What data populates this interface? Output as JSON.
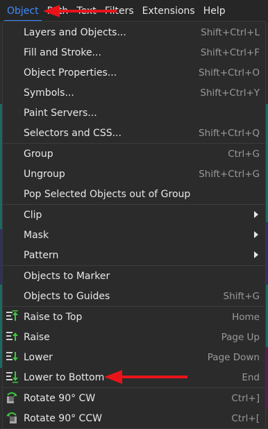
{
  "menubar": {
    "items": [
      "Object",
      "Path",
      "Text",
      "Filters",
      "Extensions",
      "Help"
    ]
  },
  "menu": {
    "items": [
      {
        "label": "Layers and Objects...",
        "shortcut": "Shift+Ctrl+L"
      },
      {
        "label": "Fill and Stroke...",
        "shortcut": "Shift+Ctrl+F"
      },
      {
        "label": "Object Properties...",
        "shortcut": "Shift+Ctrl+O"
      },
      {
        "label": "Symbols...",
        "shortcut": "Shift+Ctrl+Y"
      },
      {
        "label": "Paint Servers...",
        "shortcut": ""
      },
      {
        "label": "Selectors and CSS...",
        "shortcut": "Shift+Ctrl+Q"
      },
      {
        "label": "Group",
        "shortcut": "Ctrl+G"
      },
      {
        "label": "Ungroup",
        "shortcut": "Shift+Ctrl+G"
      },
      {
        "label": "Pop Selected Objects out of Group",
        "shortcut": ""
      },
      {
        "label": "Clip",
        "shortcut": ""
      },
      {
        "label": "Mask",
        "shortcut": ""
      },
      {
        "label": "Pattern",
        "shortcut": ""
      },
      {
        "label": "Objects to Marker",
        "shortcut": ""
      },
      {
        "label": "Objects to Guides",
        "shortcut": "Shift+G"
      },
      {
        "label": "Raise to Top",
        "shortcut": "Home"
      },
      {
        "label": "Raise",
        "shortcut": "Page Up"
      },
      {
        "label": "Lower",
        "shortcut": "Page Down"
      },
      {
        "label": "Lower to Bottom",
        "shortcut": "End"
      },
      {
        "label": "Rotate 90° CW",
        "shortcut": "Ctrl+]"
      },
      {
        "label": "Rotate 90° CCW",
        "shortcut": "Ctrl+["
      }
    ]
  },
  "colors": {
    "accent": "#3f8cff",
    "annotation": "#e8141a",
    "menu_bg": "#2b2b2b",
    "icon_green": "#3ec93e"
  },
  "icons": {
    "raise_to_top": "raise-to-top-icon",
    "raise": "raise-icon",
    "lower": "lower-icon",
    "lower_to_bottom": "lower-to-bottom-icon",
    "rotate_cw": "rotate-cw-icon",
    "rotate_ccw": "rotate-ccw-icon"
  }
}
